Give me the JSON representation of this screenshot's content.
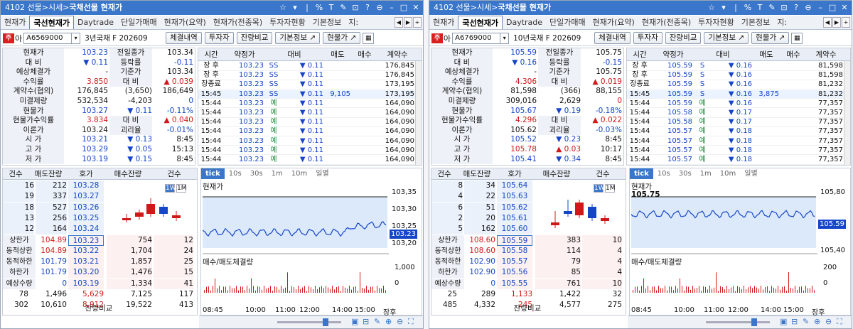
{
  "panels": [
    {
      "title": "4102 선물>시세>",
      "title_bold": "국채선물 현재가",
      "tabs": [
        "현재가",
        "국선현재가",
        "Daytrade",
        "단일가매매",
        "현재가(요약)",
        "현재가(전종목)",
        "투자자현황",
        "기본정보",
        "지:"
      ],
      "active_tab": 1,
      "code_label": "아",
      "code": "A6569000",
      "name": "3년국채 F 202609",
      "buttons": [
        "체결내역",
        "투자자",
        "잔량비교",
        "기본정보",
        "현물가"
      ],
      "stats": [
        {
          "l": "현재가",
          "v1": "103.23",
          "c1": "blue",
          "l2": "전일종가",
          "v2": "103.34",
          "c2": ""
        },
        {
          "l": "대 비",
          "v1": "▼ 0.11",
          "c1": "blue",
          "l2": "등락률",
          "v2": "-0.11",
          "c2": "blue"
        },
        {
          "l": "예상체결가",
          "v1": "-",
          "c1": "",
          "l2": "기준가",
          "v2": "103.34",
          "c2": ""
        },
        {
          "l": "수익률",
          "v1": "3.850",
          "c1": "red",
          "l2": "대 비",
          "v2": "▲ 0.039",
          "c2": "red"
        },
        {
          "l": "계약수(협의)",
          "v1": "176,845",
          "c1": "",
          "l2": "(3,650)",
          "v2": "186,649",
          "c2": ""
        },
        {
          "l": "미결제량",
          "v1": "532,534",
          "c1": "",
          "l2": "-4,203",
          "v2": "0",
          "c2": "blue"
        },
        {
          "l": "현물가",
          "v1": "103.27",
          "c1": "blue",
          "l2": "▼ 0.11",
          "v2": "-0.11%",
          "c2": "blue"
        },
        {
          "l": "현물가수익률",
          "v1": "3.834",
          "c1": "red",
          "l2": "대 비",
          "v2": "▲ 0.040",
          "c2": "red"
        },
        {
          "l": "이론가",
          "v1": "103.24",
          "c1": "",
          "l2": "괴리율",
          "v2": "-0.01%",
          "c2": "blue"
        },
        {
          "l": "시 가",
          "v1": "103.21",
          "c1": "blue",
          "l2": "▼ 0.13",
          "v2": "8:45",
          "c2": ""
        },
        {
          "l": "고 가",
          "v1": "103.29",
          "c1": "blue",
          "l2": "▼ 0.05",
          "v2": "15:13",
          "c2": ""
        },
        {
          "l": "저 가",
          "v1": "103.19",
          "c1": "blue",
          "l2": "▼ 0.15",
          "v2": "8:45",
          "c2": ""
        }
      ],
      "trade_head": [
        "시간",
        "약정가",
        "대비",
        "매도",
        "매수",
        "계약수"
      ],
      "trades": [
        [
          "장 후",
          "103.23",
          "SS",
          "▼ 0.11",
          "",
          "",
          "176,845"
        ],
        [
          "장 후",
          "103.23",
          "SS",
          "▼ 0.11",
          "",
          "",
          "176,845"
        ],
        [
          "장종료",
          "103.23",
          "SS",
          "▼ 0.11",
          "",
          "",
          "173,195"
        ],
        [
          "15:45",
          "103.23",
          "SS",
          "▼ 0.11",
          "9,105",
          "",
          "173,195"
        ],
        [
          "15:44",
          "103.23",
          "예",
          "▼ 0.11",
          "",
          "",
          "164,090"
        ],
        [
          "15:44",
          "103.23",
          "예",
          "▼ 0.11",
          "",
          "",
          "164,090"
        ],
        [
          "15:44",
          "103.23",
          "예",
          "▼ 0.11",
          "",
          "",
          "164,090"
        ],
        [
          "15:44",
          "103.23",
          "예",
          "▼ 0.11",
          "",
          "",
          "164,090"
        ],
        [
          "15:44",
          "103.23",
          "예",
          "▼ 0.11",
          "",
          "",
          "164,090"
        ],
        [
          "15:44",
          "103.23",
          "예",
          "▼ 0.11",
          "",
          "",
          "164,090"
        ],
        [
          "15:44",
          "103.23",
          "예",
          "▼ 0.11",
          "",
          "",
          "164,090"
        ]
      ],
      "ob_head": [
        "건수",
        "매도잔량",
        "호가",
        "매수잔량",
        "건수"
      ],
      "asks": [
        [
          "16",
          "212",
          "103.28"
        ],
        [
          "19",
          "337",
          "103.27"
        ],
        [
          "18",
          "527",
          "103.26"
        ],
        [
          "13",
          "256",
          "103.25"
        ],
        [
          "12",
          "164",
          "103.24"
        ]
      ],
      "bids": [
        [
          "103.23",
          "754",
          "12"
        ],
        [
          "103.22",
          "1,704",
          "24"
        ],
        [
          "103.21",
          "1,857",
          "25"
        ],
        [
          "103.20",
          "1,476",
          "15"
        ],
        [
          "103.19",
          "1,334",
          "41"
        ]
      ],
      "ob_left": [
        [
          "상한가",
          "104.89"
        ],
        [
          "동적상한",
          "104.89"
        ],
        [
          "동적하한",
          "101.79"
        ],
        [
          "하한가",
          "101.79"
        ],
        [
          "예상수량",
          "0"
        ]
      ],
      "ob_tot1": [
        "78",
        "1,496",
        "5,629",
        "7,125",
        "117"
      ],
      "ob_tot2": [
        "302",
        "10,610",
        "8,912",
        "19,522",
        "413"
      ],
      "ob_btn": "잔량비교",
      "chart_tabs": [
        "tick",
        "10s",
        "30s",
        "1m",
        "10m",
        "일별"
      ],
      "chart_label": "현재가",
      "vol_label": "매수/매도체결량",
      "price_ticks": [
        "103,35",
        "103,30",
        "103,25",
        "103,20"
      ],
      "price_tag": "103.23",
      "vol_ticks": [
        "1,000",
        "0"
      ],
      "time_ticks": [
        "08:45",
        "10:00",
        "11:00",
        "12:00",
        "14:00",
        "15:00",
        "장후"
      ],
      "w_m": [
        "1W",
        "1M"
      ],
      "prev_label": ""
    },
    {
      "title": "4102 선물>시세>",
      "title_bold": "국채선물 현재가",
      "tabs": [
        "현재가",
        "국선현재가",
        "Daytrade",
        "단일가매매",
        "현재가(요약)",
        "현재가(전종목)",
        "투자자현황",
        "기본정보",
        "지:"
      ],
      "active_tab": 1,
      "code_label": "아",
      "code": "A6769000",
      "name": "10년국채 F 202609",
      "buttons": [
        "체결내역",
        "투자자",
        "잔량비교",
        "기본정보",
        "현물가"
      ],
      "stats": [
        {
          "l": "현재가",
          "v1": "105.59",
          "c1": "blue",
          "l2": "전일종가",
          "v2": "105.75",
          "c2": ""
        },
        {
          "l": "대 비",
          "v1": "▼ 0.16",
          "c1": "blue",
          "l2": "등락률",
          "v2": "-0.15",
          "c2": "blue"
        },
        {
          "l": "예상체결가",
          "v1": "-",
          "c1": "",
          "l2": "기준가",
          "v2": "105.75",
          "c2": ""
        },
        {
          "l": "수익률",
          "v1": "4.306",
          "c1": "red",
          "l2": "대 비",
          "v2": "▲ 0.019",
          "c2": "red"
        },
        {
          "l": "계약수(협의)",
          "v1": "81,598",
          "c1": "",
          "l2": "(366)",
          "v2": "88,155",
          "c2": ""
        },
        {
          "l": "미결제량",
          "v1": "309,016",
          "c1": "",
          "l2": "2,629",
          "v2": "0",
          "c2": "red"
        },
        {
          "l": "현물가",
          "v1": "105.67",
          "c1": "blue",
          "l2": "▼ 0.19",
          "v2": "-0.18%",
          "c2": "blue"
        },
        {
          "l": "현물가수익률",
          "v1": "4.296",
          "c1": "red",
          "l2": "대 비",
          "v2": "▲ 0.022",
          "c2": "red"
        },
        {
          "l": "이론가",
          "v1": "105.62",
          "c1": "",
          "l2": "괴리율",
          "v2": "-0.03%",
          "c2": "blue"
        },
        {
          "l": "시 가",
          "v1": "105.52",
          "c1": "blue",
          "l2": "▼ 0.23",
          "v2": "8:45",
          "c2": ""
        },
        {
          "l": "고 가",
          "v1": "105.78",
          "c1": "red",
          "l2": "▲ 0.03",
          "v2": "10:17",
          "c2": ""
        },
        {
          "l": "저 가",
          "v1": "105.41",
          "c1": "blue",
          "l2": "▼ 0.34",
          "v2": "8:45",
          "c2": ""
        }
      ],
      "trade_head": [
        "시간",
        "약정가",
        "대비",
        "매도",
        "매수",
        "계약수"
      ],
      "trades": [
        [
          "장 후",
          "105.59",
          "S",
          "▼ 0.16",
          "",
          "",
          "81,598"
        ],
        [
          "장 후",
          "105.59",
          "S",
          "▼ 0.16",
          "",
          "",
          "81,598"
        ],
        [
          "장종료",
          "105.59",
          "S",
          "▼ 0.16",
          "",
          "",
          "81,232"
        ],
        [
          "15:45",
          "105.59",
          "S",
          "▼ 0.16",
          "3,875",
          "",
          "81,232"
        ],
        [
          "15:44",
          "105.59",
          "예",
          "▼ 0.16",
          "",
          "",
          "77,357"
        ],
        [
          "15:44",
          "105.58",
          "예",
          "▼ 0.17",
          "",
          "",
          "77,357"
        ],
        [
          "15:44",
          "105.58",
          "예",
          "▼ 0.17",
          "",
          "",
          "77,357"
        ],
        [
          "15:44",
          "105.57",
          "예",
          "▼ 0.18",
          "",
          "",
          "77,357"
        ],
        [
          "15:44",
          "105.57",
          "예",
          "▼ 0.18",
          "",
          "",
          "77,357"
        ],
        [
          "15:44",
          "105.57",
          "예",
          "▼ 0.18",
          "",
          "",
          "77,357"
        ],
        [
          "15:44",
          "105.57",
          "예",
          "▼ 0.18",
          "",
          "",
          "77,357"
        ]
      ],
      "ob_head": [
        "건수",
        "매도잔량",
        "호가",
        "매수잔량",
        "건수"
      ],
      "asks": [
        [
          "8",
          "34",
          "105.64"
        ],
        [
          "4",
          "22",
          "105.63"
        ],
        [
          "6",
          "51",
          "105.62"
        ],
        [
          "2",
          "20",
          "105.61"
        ],
        [
          "5",
          "162",
          "105.60"
        ]
      ],
      "bids": [
        [
          "105.59",
          "383",
          "10"
        ],
        [
          "105.58",
          "114",
          "4"
        ],
        [
          "105.57",
          "79",
          "4"
        ],
        [
          "105.56",
          "85",
          "4"
        ],
        [
          "105.55",
          "761",
          "10"
        ]
      ],
      "ob_left": [
        [
          "상한가",
          "108.60"
        ],
        [
          "동적상한",
          "108.60"
        ],
        [
          "동적하한",
          "102.90"
        ],
        [
          "하한가",
          "102.90"
        ],
        [
          "예상수량",
          "0"
        ]
      ],
      "ob_tot1": [
        "25",
        "289",
        "1,133",
        "1,422",
        "32"
      ],
      "ob_tot2": [
        "485",
        "4,332",
        "245",
        "4,577",
        "275"
      ],
      "ob_btn": "잔량비교",
      "chart_tabs": [
        "tick",
        "10s",
        "30s",
        "1m",
        "10m",
        "일별"
      ],
      "chart_label": "현재가",
      "vol_label": "매수/매도체결량",
      "price_ticks": [
        "105,80",
        "105,40"
      ],
      "price_tag": "105.59",
      "vol_ticks": [
        "200",
        "0"
      ],
      "time_ticks": [
        "08:45",
        "10:00",
        "11:00",
        "12:00",
        "14:00",
        "15:00",
        "장후"
      ],
      "w_m": [
        "1W",
        "1M"
      ],
      "prev_label": "105.75"
    }
  ],
  "colors": {
    "blue": "#1546c8",
    "red": "#d11818",
    "title": "#3a76c9"
  }
}
